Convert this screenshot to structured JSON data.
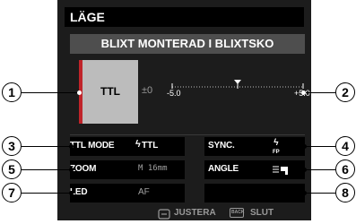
{
  "header": {
    "title": "LÄGE"
  },
  "mode_bar": {
    "label": "BLIXT MONTERAD I BLIXTSKO"
  },
  "flash": {
    "mode_label": "TTL",
    "compensation": "±0",
    "scale_min_label": "-5.0",
    "scale_max_label": "+5.0"
  },
  "settings": {
    "ttl_mode": {
      "label": "TTL MODE",
      "value": "TTL"
    },
    "sync": {
      "label": "SYNC."
    },
    "zoom": {
      "label": "ZOOM",
      "value": "M 16mm"
    },
    "angle": {
      "label": "ANGLE"
    },
    "led": {
      "label": "LED",
      "value": "AF"
    }
  },
  "callouts": [
    "1",
    "2",
    "3",
    "4",
    "5",
    "6",
    "7",
    "8"
  ],
  "footer": {
    "adjust_label": "JUSTERA",
    "back_icon": "BACK",
    "exit_label": "SLUT"
  },
  "colors": {
    "accent_red": "#c0242a",
    "screen_bg": "#1c1c1c",
    "tile_bg": "#000000"
  }
}
